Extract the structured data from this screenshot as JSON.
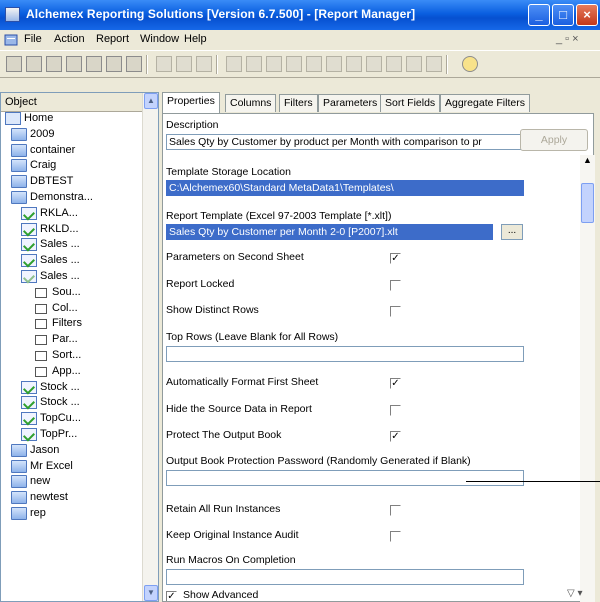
{
  "window": {
    "title": "Alchemex Reporting Solutions [Version 6.7.500] - [Report Manager]",
    "min_glyph": "_",
    "max_glyph": "□",
    "close_glyph": "×"
  },
  "menubar": {
    "items": [
      "File",
      "Action",
      "Report",
      "Window",
      "Help"
    ],
    "mdi_controls": "_ ▫ ×"
  },
  "tree": {
    "header": "Object",
    "nodes": [
      {
        "label": "Home",
        "icon": "home-icon",
        "level": 0
      },
      {
        "label": "2009",
        "icon": "folder-icon",
        "level": 1
      },
      {
        "label": "container",
        "icon": "folder-icon",
        "level": 1
      },
      {
        "label": "Craig",
        "icon": "folder-icon",
        "level": 1
      },
      {
        "label": "DBTEST",
        "icon": "folder-icon",
        "level": 1
      },
      {
        "label": "Demonstra...",
        "icon": "folder-icon",
        "level": 1
      },
      {
        "label": "RKLA...",
        "icon": "report-icon",
        "level": 2
      },
      {
        "label": "RKLD...",
        "icon": "report-icon",
        "level": 2
      },
      {
        "label": "Sales ...",
        "icon": "report-icon",
        "level": 2
      },
      {
        "label": "Sales ...",
        "icon": "report-icon",
        "level": 2
      },
      {
        "label": "Sales ...",
        "icon": "report-icon-lite",
        "level": 2
      },
      {
        "label": "Sou...",
        "icon": "item-icon",
        "level": 3
      },
      {
        "label": "Col...",
        "icon": "item-icon",
        "level": 3
      },
      {
        "label": "Filters",
        "icon": "item-icon",
        "level": 3
      },
      {
        "label": "Par...",
        "icon": "item-icon",
        "level": 3
      },
      {
        "label": "Sort...",
        "icon": "item-icon",
        "level": 3
      },
      {
        "label": "App...",
        "icon": "item-icon",
        "level": 3
      },
      {
        "label": "Stock ...",
        "icon": "report-icon",
        "level": 2
      },
      {
        "label": "Stock ...",
        "icon": "report-icon",
        "level": 2
      },
      {
        "label": "TopCu...",
        "icon": "report-icon",
        "level": 2
      },
      {
        "label": "TopPr...",
        "icon": "report-icon",
        "level": 2
      },
      {
        "label": "Jason",
        "icon": "folder-icon",
        "level": 1
      },
      {
        "label": "Mr Excel",
        "icon": "folder-icon",
        "level": 1
      },
      {
        "label": "new",
        "icon": "folder-icon",
        "level": 1
      },
      {
        "label": "newtest",
        "icon": "folder-icon",
        "level": 1
      },
      {
        "label": "rep",
        "icon": "folder-icon",
        "level": 1
      }
    ]
  },
  "tabs": [
    "Properties",
    "Columns",
    "Filters",
    "Parameters",
    "Sort Fields",
    "Aggregate Filters"
  ],
  "apply_label": "Apply",
  "props": {
    "description_label": "Description",
    "description_value": "Sales Qty by Customer by product per Month with comparison to pr",
    "storage_label": "Template Storage Location",
    "storage_value": "C:\\Alchemex60\\Standard MetaData1\\Templates\\",
    "template_label": "Report Template (Excel 97-2003 Template [*.xlt])",
    "template_value": "Sales Qty by Customer per Month 2-0 [P2007].xlt",
    "ellipsis": "...",
    "param_second_sheet": "Parameters on Second Sheet",
    "report_locked": "Report Locked",
    "show_distinct": "Show Distinct Rows",
    "top_rows_label": "Top Rows (Leave Blank for All Rows)",
    "top_rows_value": "",
    "auto_format": "Automatically Format First Sheet",
    "hide_source": "Hide the Source Data in Report",
    "protect_output": "Protect The Output Book",
    "protection_pw_label": "Output Book Protection Password (Randomly Generated if Blank)",
    "protection_pw_value": "",
    "retain_instances": "Retain All Run Instances",
    "keep_original": "Keep Original Instance Audit",
    "run_macros_label": "Run Macros On Completion",
    "run_macros_value": "",
    "show_advanced": "Show Advanced",
    "checked_glyph": "✓",
    "expand_glyph": "▽ ▾"
  }
}
